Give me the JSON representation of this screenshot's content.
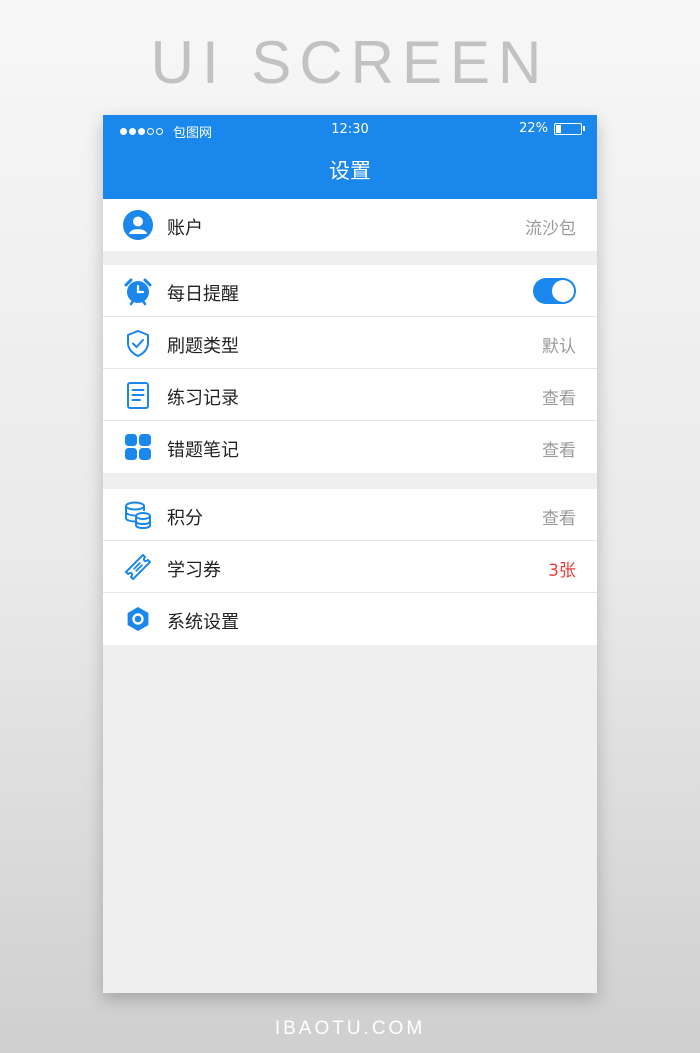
{
  "poster": {
    "top_label": "UI SCREEN",
    "bottom_label": "IBAOTU.COM"
  },
  "status_bar": {
    "carrier": "包图网",
    "time": "12:30",
    "battery_percent": "22%",
    "battery_level": 0.22,
    "signal_bars_filled": 3,
    "signal_bars_total": 5
  },
  "header": {
    "title": "设置"
  },
  "account": {
    "icon": "user-avatar-icon",
    "label": "账户",
    "value": "流沙包"
  },
  "section_one": [
    {
      "icon": "alarm-clock-icon",
      "label": "每日提醒",
      "toggle_on": true
    },
    {
      "icon": "shield-check-icon",
      "label": "刷题类型",
      "value": "默认"
    },
    {
      "icon": "document-icon",
      "label": "练习记录",
      "value": "查看"
    },
    {
      "icon": "grid-apps-icon",
      "label": "错题笔记",
      "value": "查看"
    }
  ],
  "section_two": [
    {
      "icon": "coin-stack-icon",
      "label": "积分",
      "value": "查看"
    },
    {
      "icon": "ticket-icon",
      "label": "学习券",
      "value": "3张"
    },
    {
      "icon": "hexagon-settings-icon",
      "label": "系统设置"
    }
  ],
  "colors": {
    "accent": "#1a87ec",
    "highlight": "#f13b3b",
    "muted_text": "#9a9a9a",
    "background": "#efefef"
  }
}
